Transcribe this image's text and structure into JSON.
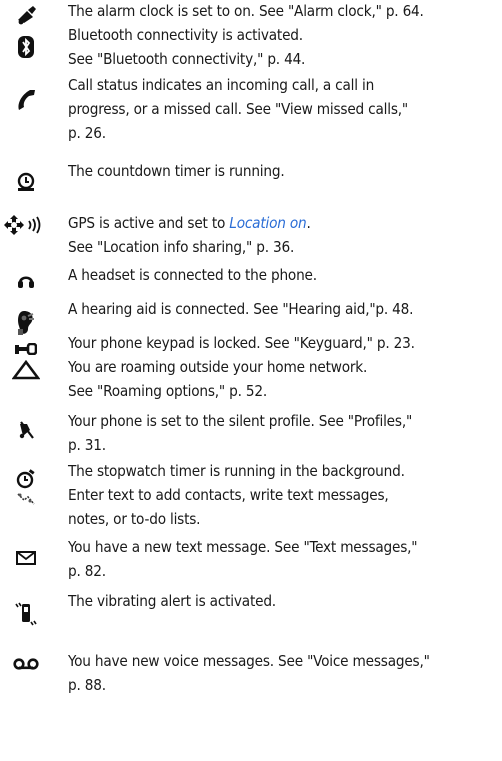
{
  "entries": [
    {
      "icon": "alarm-clock-icon",
      "lines": [
        "The alarm clock is set to on. See \"Alarm clock,\" p. 64."
      ]
    },
    {
      "icon": "bluetooth-icon",
      "lines": [
        "Bluetooth connectivity is activated.",
        "See \"Bluetooth connectivity,\" p. 44."
      ]
    },
    {
      "icon": "call-handset-icon",
      "lines": [
        "Call status indicates an incoming call, a call in",
        "progress, or a missed call.   See \"View missed calls,\"",
        "p. 26."
      ]
    },
    {
      "icon": "countdown-timer-icon",
      "lines": [
        "The countdown timer is running."
      ]
    },
    {
      "icon": "gps-icon",
      "lines": [
        "See \"Location info sharing,\" p. 36."
      ],
      "prefix": "GPS is active and set to ",
      "link": "Location on",
      "suffix": "."
    },
    {
      "icon": "headset-icon",
      "lines": [
        "A headset is connected to the phone."
      ]
    },
    {
      "icon": "hearing-aid-icon",
      "lines": [
        "A hearing aid is connected. See \"Hearing aid,\"p. 48."
      ]
    },
    {
      "icon": "keypad-lock-icon",
      "lines": [
        "Your phone keypad is locked. See \"Keyguard,\" p. 23."
      ]
    },
    {
      "icon": "roaming-icon",
      "lines": [
        "You are roaming outside your home network.",
        "See \"Roaming options,\" p. 52."
      ]
    },
    {
      "icon": "silent-profile-icon",
      "lines": [
        "Your phone is set to the silent profile. See \"Profiles,\"",
        "p. 31."
      ]
    },
    {
      "icon": "stopwatch-icon",
      "lines": [
        "The stopwatch timer is running in the background."
      ]
    },
    {
      "icon": "text-input-icon",
      "lines": [
        "Enter text to add contacts, write text messages,",
        "notes, or to-do lists."
      ]
    },
    {
      "icon": "envelope-icon",
      "lines": [
        "You have a new text message. See \"Text messages,\"",
        "p. 82."
      ]
    },
    {
      "icon": "vibrating-alert-icon",
      "lines": [
        "The vibrating alert is activated."
      ]
    },
    {
      "icon": "voicemail-icon",
      "lines": [
        "You have new voice messages. See \"Voice messages,\"",
        "p. 88."
      ]
    }
  ]
}
